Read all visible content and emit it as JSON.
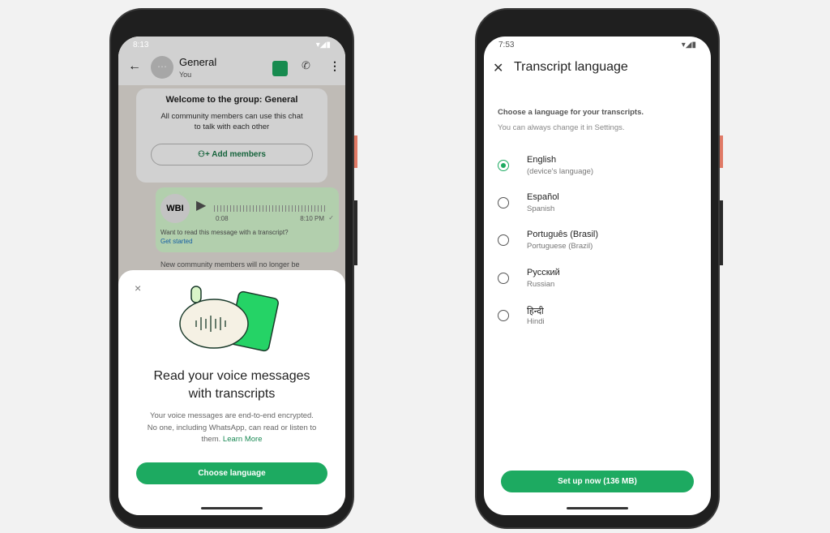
{
  "left_phone": {
    "status_time": "8:13",
    "header": {
      "title": "General",
      "subtitle": "You"
    },
    "welcome": {
      "title": "Welcome to the group: General",
      "body": "All community members can use this chat to talk with each other",
      "add_members": "Add members"
    },
    "voice_message": {
      "avatar_text": "WBI",
      "duration": "0:08",
      "time": "8:10 PM",
      "prompt": "Want to read this message with a transcript?",
      "link": "Get started"
    },
    "notice": "New community members will no longer be",
    "sheet": {
      "title": "Read your voice messages with transcripts",
      "body": "Your voice messages are end-to-end encrypted. No one, including WhatsApp, can read or listen to them.",
      "learn_more": "Learn More",
      "button": "Choose language"
    }
  },
  "right_phone": {
    "status_time": "7:53",
    "title": "Transcript language",
    "instruction": "Choose a language for your transcripts.",
    "hint": "You can always change it in Settings.",
    "languages": [
      {
        "name": "English",
        "sub": "(device's language)",
        "selected": true
      },
      {
        "name": "Español",
        "sub": "Spanish",
        "selected": false
      },
      {
        "name": "Português (Brasil)",
        "sub": "Portuguese (Brazil)",
        "selected": false
      },
      {
        "name": "Русский",
        "sub": "Russian",
        "selected": false
      },
      {
        "name": "हिन्दी",
        "sub": "Hindi",
        "selected": false
      }
    ],
    "button": "Set up now (136 MB)"
  },
  "colors": {
    "accent": "#1daa61",
    "link": "#1a73c8"
  }
}
